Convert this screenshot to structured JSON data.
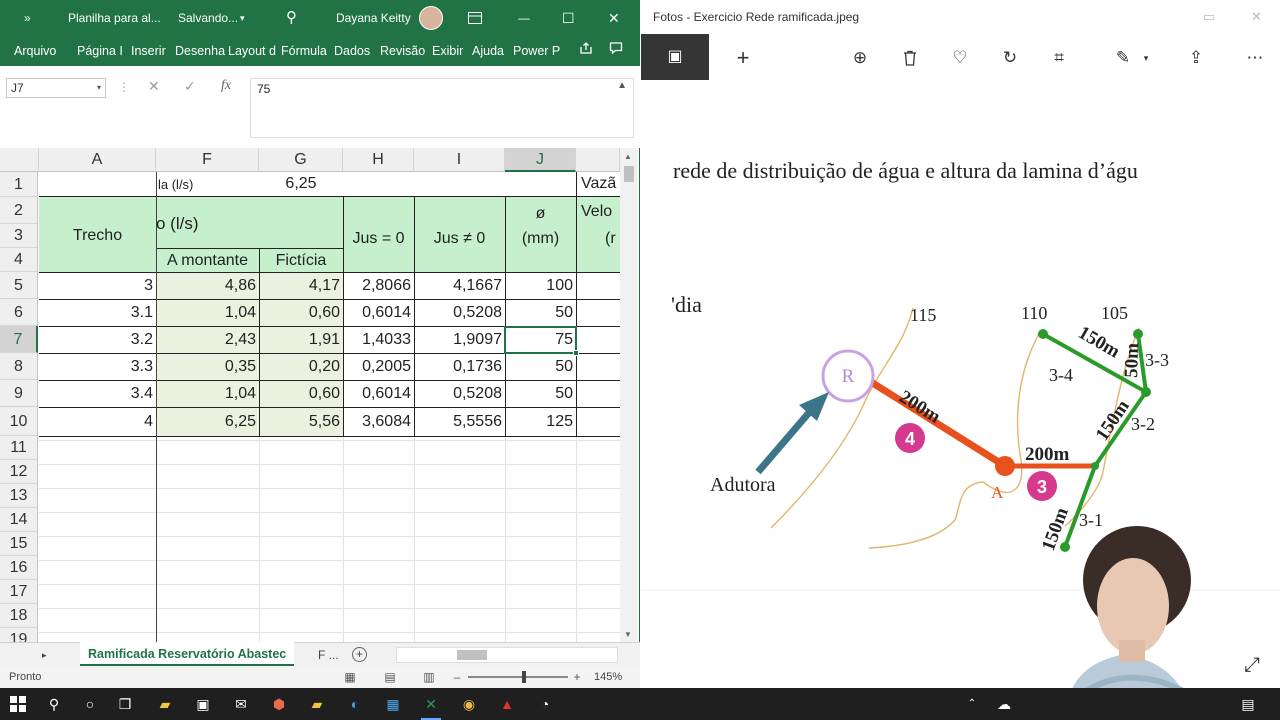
{
  "excel": {
    "titlebar": {
      "more_glyph": "»",
      "doc_title": "Planilha para al...",
      "save_status": "Salvando...",
      "chevron": "▾",
      "search_glyph": "⚲",
      "user_name": "Dayana Keitty",
      "min_glyph": "—",
      "max_glyph": "☐",
      "close_glyph": "✕"
    },
    "ribbon_tabs": [
      "Arquivo",
      "Página I",
      "Inserir",
      "Desenha",
      "Layout d",
      "Fórmula",
      "Dados",
      "Revisão",
      "Exibir",
      "Ajuda",
      "Power P"
    ],
    "formula_bar": {
      "name_box": "J7",
      "dropdown": "▾",
      "dots": "⋮",
      "cancel": "✕",
      "enter": "✓",
      "fx": "fx",
      "value": "75",
      "collapse": "▲"
    },
    "columns": [
      "A",
      "F",
      "G",
      "H",
      "I",
      "J"
    ],
    "rows": [
      "1",
      "2",
      "3",
      "4",
      "5",
      "6",
      "7",
      "8",
      "9",
      "10",
      "11",
      "12",
      "13",
      "14",
      "15",
      "16",
      "17",
      "18",
      "19"
    ],
    "header": {
      "r1_F": "la (l/s)",
      "r1_G": "6,25",
      "r1_K": "Vazã",
      "trecho": "Trecho",
      "vazao": "o (l/s)",
      "jus0": "Jus = 0",
      "jusn0": "Jus ≠ 0",
      "diam_a": "ø",
      "diam_b": "(mm)",
      "velo_a": "Velo",
      "velo_b": "(r",
      "montante": "A montante",
      "ficticia": "Fictícia"
    },
    "data_rows": [
      {
        "trecho": "3",
        "montante": "4,86",
        "ficticia": "4,17",
        "jus0": "2,8066",
        "jusn0": "4,1667",
        "diam": "100"
      },
      {
        "trecho": "3.1",
        "montante": "1,04",
        "ficticia": "0,60",
        "jus0": "0,6014",
        "jusn0": "0,5208",
        "diam": "50"
      },
      {
        "trecho": "3.2",
        "montante": "2,43",
        "ficticia": "1,91",
        "jus0": "1,4033",
        "jusn0": "1,9097",
        "diam": "75"
      },
      {
        "trecho": "3.3",
        "montante": "0,35",
        "ficticia": "0,20",
        "jus0": "0,2005",
        "jusn0": "0,1736",
        "diam": "50"
      },
      {
        "trecho": "3.4",
        "montante": "1,04",
        "ficticia": "0,60",
        "jus0": "0,6014",
        "jusn0": "0,5208",
        "diam": "50"
      },
      {
        "trecho": "4",
        "montante": "6,25",
        "ficticia": "5,56",
        "jus0": "3,6084",
        "jusn0": "5,5556",
        "diam": "125"
      }
    ],
    "sheet_tabs": {
      "active": "Ramificada Reservatório Abastec",
      "next": "F ...",
      "add": "+",
      "nav": "▸"
    },
    "status": {
      "text": "Pronto",
      "zoom": "145%",
      "minus": "–",
      "plus": "+"
    }
  },
  "photos": {
    "title": "Fotos - Exercicio Rede ramificada.jpeg",
    "heading": "rede de distribuição de água e altura da lamina d’águ",
    "dia_text": "'dia",
    "toolbar_glyphs": {
      "image": "▣",
      "add": "+",
      "zoom": "⊕",
      "delete": "🗑",
      "favorite": "♡",
      "rotate": "↻",
      "crop": "⌗",
      "edit": "✎",
      "share": "⇪",
      "more": "⋯"
    },
    "expand_glyph": "⤢",
    "diagram": {
      "reservoir_label": "R",
      "adutora_label": "Adutora",
      "node_a_label": "A",
      "badge_4": "4",
      "badge_3": "3",
      "len_200_a": "200m",
      "len_200_b": "200m",
      "len_150_a": "150m",
      "len_150_b": "150m",
      "len_150_c": "150m",
      "len_50": "50m",
      "contour_115": "115",
      "contour_110": "110",
      "contour_105": "105",
      "seg_33": "3-3",
      "seg_34": "3-4",
      "seg_32": "3-2",
      "seg_31": "3-1"
    }
  },
  "colors": {
    "excel_green": "#217346",
    "header_green": "#c6efce",
    "data_cream": "#ebf1de",
    "pipe_orange": "#e8501c",
    "pipe_green": "#2a9a2a",
    "badge_pink": "#d63a8f",
    "reservoir_purple": "#c9a2e6",
    "arrow_teal": "#3c7588"
  }
}
